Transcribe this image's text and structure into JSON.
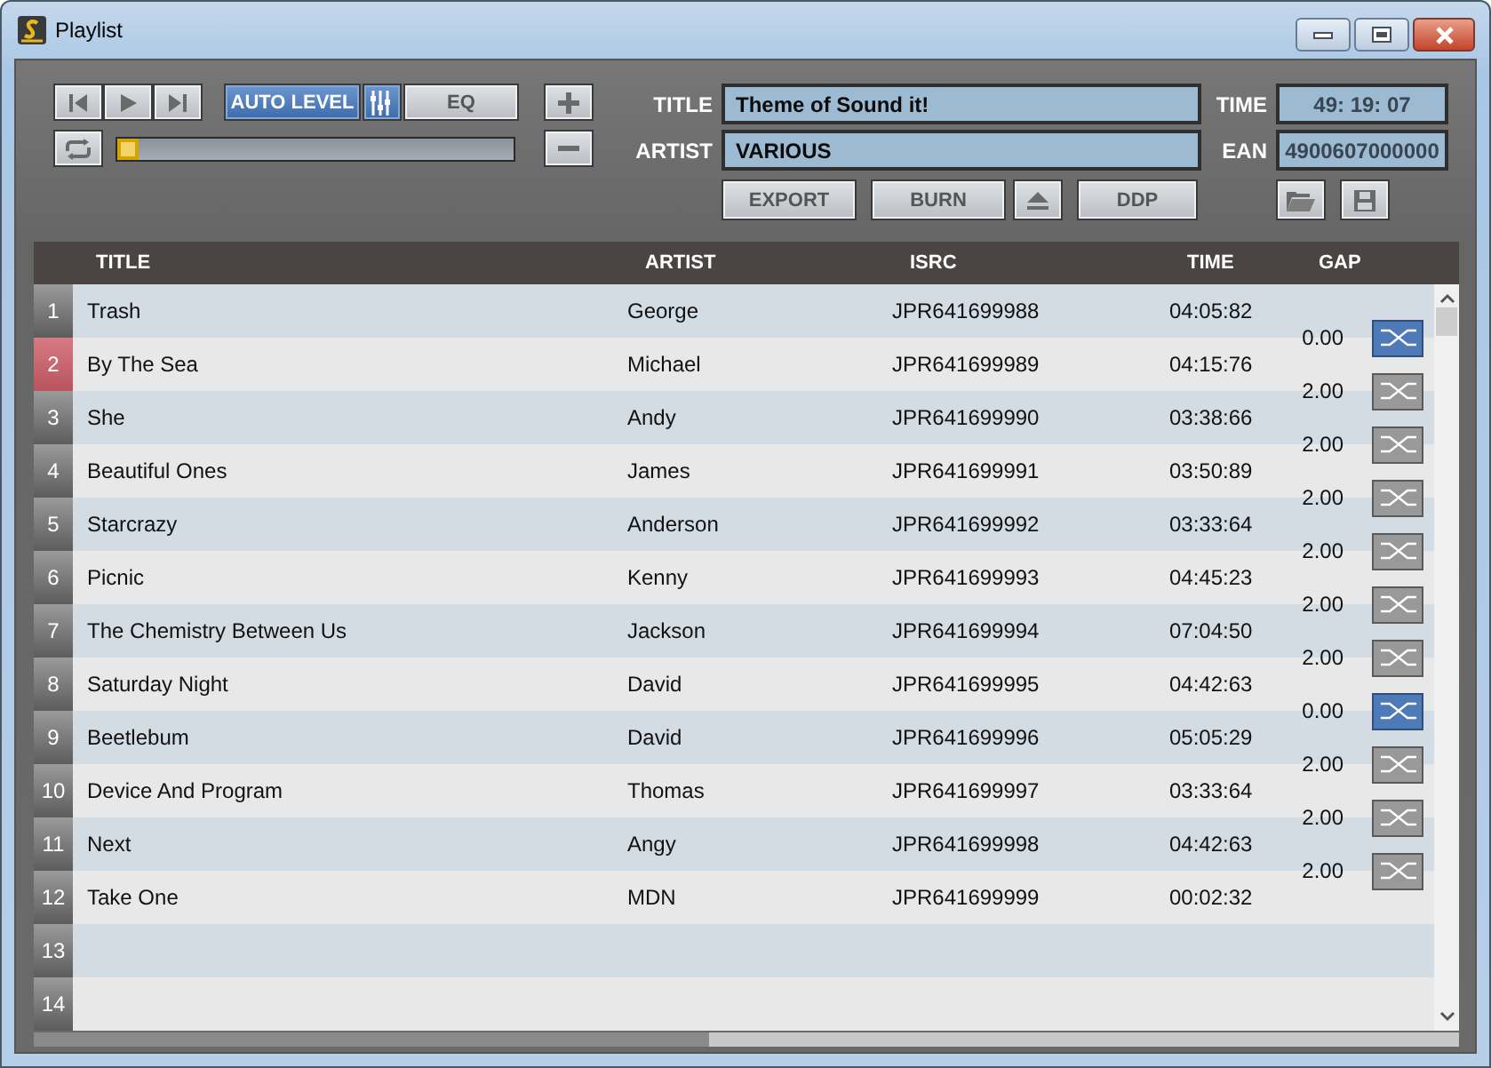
{
  "window": {
    "title": "Playlist"
  },
  "toolbar": {
    "toggles": [
      {
        "kind": "text",
        "label": "AUTO LEVEL",
        "on": true
      },
      {
        "kind": "mixer",
        "on": true
      },
      {
        "kind": "text",
        "label": "EQ",
        "on": false
      }
    ],
    "position": {
      "level": 0
    }
  },
  "disc": {
    "title_label": "TITLE",
    "title": "Theme of Sound it!",
    "artist_label": "ARTIST",
    "artist": "VARIOUS",
    "time_label": "TIME",
    "time": "49: 19: 07",
    "ean_label": "EAN",
    "ean": "4900607000000"
  },
  "actions": [
    {
      "kind": "text",
      "label": "EXPORT"
    },
    {
      "kind": "text",
      "label": "BURN"
    },
    {
      "kind": "eject"
    },
    {
      "kind": "text",
      "label": "DDP"
    }
  ],
  "table": {
    "columns": [
      "TITLE",
      "ARTIST",
      "ISRC",
      "TIME",
      "GAP"
    ],
    "rows": [
      {
        "number": "1",
        "title": "Trash",
        "artist": "George",
        "isrc": "JPR641699988",
        "time": "04:05:82",
        "selected": false,
        "gap": {
          "value": "0.00",
          "selected": true
        }
      },
      {
        "number": "2",
        "title": "By The Sea",
        "artist": "Michael",
        "isrc": "JPR641699989",
        "time": "04:15:76",
        "selected": true,
        "gap": {
          "value": "2.00",
          "selected": false
        }
      },
      {
        "number": "3",
        "title": "She",
        "artist": "Andy",
        "isrc": "JPR641699990",
        "time": "03:38:66",
        "selected": false,
        "gap": {
          "value": "2.00",
          "selected": false
        }
      },
      {
        "number": "4",
        "title": "Beautiful Ones",
        "artist": "James",
        "isrc": "JPR641699991",
        "time": "03:50:89",
        "selected": false,
        "gap": {
          "value": "2.00",
          "selected": false
        }
      },
      {
        "number": "5",
        "title": "Starcrazy",
        "artist": "Anderson",
        "isrc": "JPR641699992",
        "time": "03:33:64",
        "selected": false,
        "gap": {
          "value": "2.00",
          "selected": false
        }
      },
      {
        "number": "6",
        "title": "Picnic",
        "artist": "Kenny",
        "isrc": "JPR641699993",
        "time": "04:45:23",
        "selected": false,
        "gap": {
          "value": "2.00",
          "selected": false
        }
      },
      {
        "number": "7",
        "title": "The Chemistry Between Us",
        "artist": "Jackson",
        "isrc": "JPR641699994",
        "time": "07:04:50",
        "selected": false,
        "gap": {
          "value": "2.00",
          "selected": false
        }
      },
      {
        "number": "8",
        "title": "Saturday Night",
        "artist": "David",
        "isrc": "JPR641699995",
        "time": "04:42:63",
        "selected": false,
        "gap": {
          "value": "0.00",
          "selected": true
        }
      },
      {
        "number": "9",
        "title": "Beetlebum",
        "artist": "David",
        "isrc": "JPR641699996",
        "time": "05:05:29",
        "selected": false,
        "gap": {
          "value": "2.00",
          "selected": false
        }
      },
      {
        "number": "10",
        "title": "Device And Program",
        "artist": "Thomas",
        "isrc": "JPR641699997",
        "time": "03:33:64",
        "selected": false,
        "gap": {
          "value": "2.00",
          "selected": false
        }
      },
      {
        "number": "11",
        "title": "Next",
        "artist": "Angy",
        "isrc": "JPR641699998",
        "time": "04:42:63",
        "selected": false,
        "gap": {
          "value": "2.00",
          "selected": false
        }
      },
      {
        "number": "12",
        "title": "Take One",
        "artist": "MDN",
        "isrc": "JPR641699999",
        "time": "00:02:32",
        "selected": false
      },
      {
        "number": "13",
        "selected": false
      },
      {
        "number": "14",
        "selected": false
      }
    ]
  }
}
